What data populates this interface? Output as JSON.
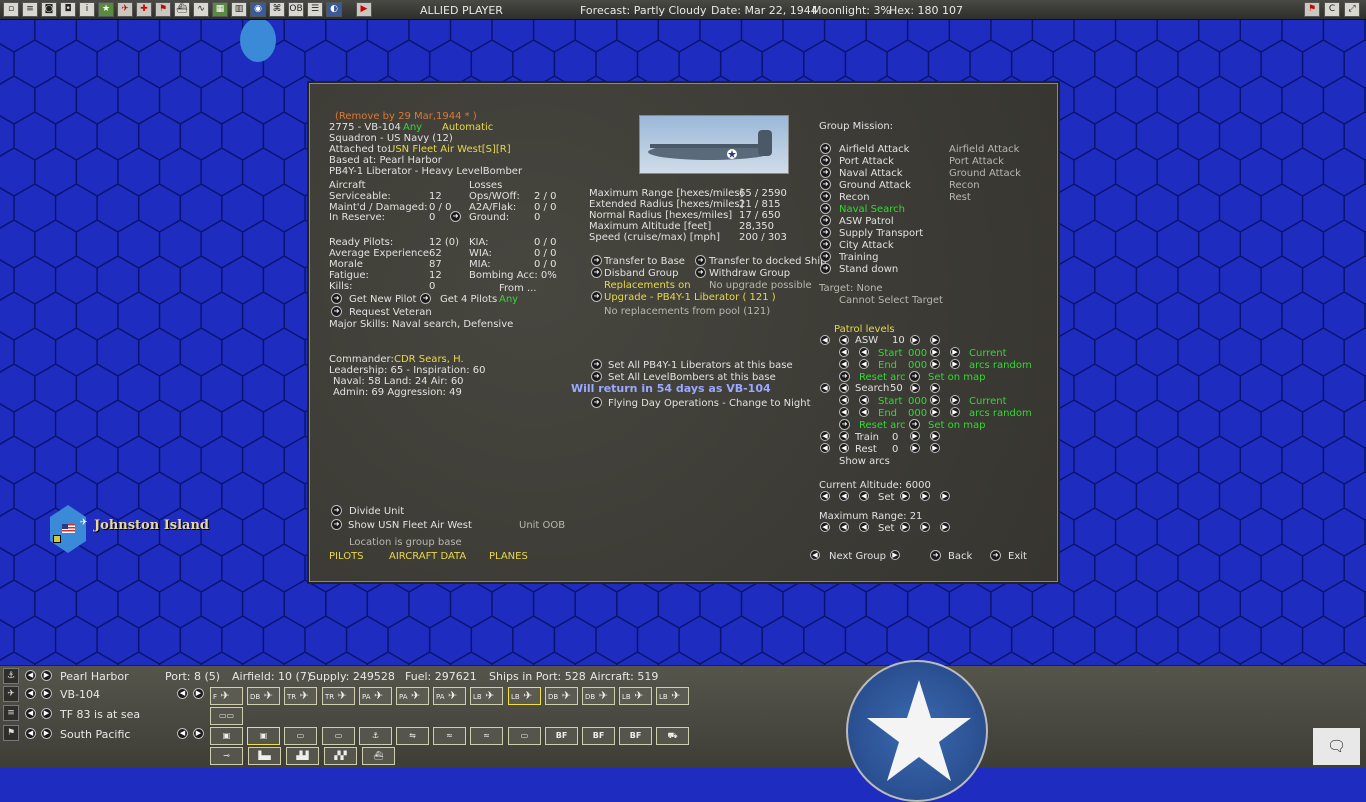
{
  "topbar": {
    "player": "ALLIED PLAYER",
    "forecast": "Forecast: Partly Cloudy",
    "date": "Date: Mar 22, 1944",
    "moonlight": "Moonlight: 3%",
    "hex": "Hex: 180 107"
  },
  "map": {
    "base_name": "Johnston Island"
  },
  "unit": {
    "remove": "(Remove by 29 Mar,1944 * )",
    "id": "2775 - VB-104",
    "any": "Any",
    "automatic": "Automatic",
    "squadron": "Squadron - US Navy (12)",
    "attached_label": "Attached to:",
    "attached_value": "USN Fleet Air West[S][R]",
    "based": "Based at: Pearl Harbor",
    "aircraft_type": "PB4Y-1 Liberator - Heavy LevelBomber",
    "aircraft_header": "Aircraft",
    "losses_header": "Losses",
    "serviceable_l": "Serviceable:",
    "serviceable_v": "12",
    "opswoff_l": "Ops/WOff:",
    "opswoff_v": "2 / 0",
    "maintd_l": "Maint'd / Damaged:",
    "maintd_v": "0 / 0",
    "a2a_l": "A2A/Flak:",
    "a2a_v": "0 / 0",
    "reserve_l": "In Reserve:",
    "reserve_v": "0",
    "ground_l": "Ground:",
    "ground_v": "0",
    "ready_l": "Ready Pilots:",
    "ready_v": "12 (0)",
    "kia_l": "KIA:",
    "kia_v": "0 / 0",
    "avgexp_l": "Average Experience",
    "avgexp_v": "62",
    "wia_l": "WIA:",
    "wia_v": "0 / 0",
    "morale_l": "Morale",
    "morale_v": "87",
    "mia_l": "MIA:",
    "mia_v": "0 / 0",
    "fatigue_l": "Fatigue:",
    "fatigue_v": "12",
    "bombacc": "Bombing Acc: 0%",
    "kills_l": "Kills:",
    "kills_v": "0",
    "from": "From ...",
    "get_new_pilot": "Get New Pilot",
    "get_4_pilots": "Get 4 Pilots",
    "any2": "Any",
    "request_veteran": "Request Veteran",
    "major_skills": "Major Skills: Naval search, Defensive",
    "commander_l": "Commander:",
    "commander_v": "CDR Sears, H.",
    "leadership": "Leadership: 65 - Inspiration: 60",
    "naval": "Naval: 58  Land: 24  Air: 60",
    "admin": "Admin: 69  Aggression: 49",
    "divide": "Divide Unit",
    "show_fleet": "Show USN Fleet Air West",
    "unit_oob": "Unit OOB",
    "location": "Location is group base",
    "tab_pilots": "PILOTS",
    "tab_aircraft": "AIRCRAFT DATA",
    "tab_planes": "PLANES"
  },
  "perf": {
    "maxrange_l": "Maximum Range [hexes/miles]",
    "maxrange_v": "65 / 2590",
    "extrad_l": "Extended Radius [hexes/miles]",
    "extrad_v": "21 / 815",
    "normrad_l": "Normal Radius [hexes/miles]",
    "normrad_v": "17 / 650",
    "maxalt_l": "Maximum Altitude [feet]",
    "maxalt_v": "28,350",
    "speed_l": "Speed (cruise/max) [mph]",
    "speed_v": "200 / 303",
    "transfer_base": "Transfer to Base",
    "transfer_ship": "Transfer to docked Ship",
    "disband": "Disband Group",
    "withdraw": "Withdraw Group",
    "replacements_on": "Replacements on",
    "no_upgrade": "No upgrade possible",
    "upgrade": "Upgrade - PB4Y-1 Liberator  ( 121 )",
    "no_repl": "No replacements from pool (121)",
    "set_all_lib": "Set All PB4Y-1 Liberators at this base",
    "set_all_lb": "Set All LevelBombers at this base",
    "will_return": "Will return in 54 days as VB-104",
    "flying_day": "Flying Day Operations - Change to Night"
  },
  "mission": {
    "header": "Group Mission:",
    "items": [
      "Airfield Attack",
      "Port Attack",
      "Naval Attack",
      "Ground Attack",
      "Recon",
      "Naval Search",
      "ASW Patrol",
      "Supply Transport",
      "City Attack",
      "Training",
      "Stand down"
    ],
    "secondary": [
      "Airfield Attack",
      "Port Attack",
      "Ground Attack",
      "Recon",
      "Rest"
    ],
    "target": "Target: None",
    "cannot_select": "Cannot Select Target",
    "patrol_levels": "Patrol levels",
    "asw_l": "ASW",
    "asw_v": "10",
    "start_l": "Start",
    "start_v": "000",
    "end_l": "End",
    "end_v": "000",
    "current": "Current",
    "arcs_random": "arcs random",
    "reset_arc": "Reset arc",
    "set_on_map": "Set on map",
    "search_l": "Search",
    "search_v": "50",
    "train_l": "Train",
    "train_v": "0",
    "rest_l": "Rest",
    "rest_v": "0",
    "show_arcs": "Show arcs",
    "cur_alt": "Current Altitude: 6000",
    "set": "Set",
    "max_range": "Maximum Range: 21",
    "next_group": "Next Group",
    "back": "Back",
    "exit": "Exit"
  },
  "bottom": {
    "base": "Pearl Harbor",
    "port": "Port: 8 (5)",
    "airfield": "Airfield: 10 (7)",
    "supply": "Supply: 249528",
    "fuel": "Fuel: 297621",
    "ships": "Ships in Port: 528",
    "aircraft": "Aircraft: 519",
    "squadron": "VB-104",
    "tf": "TF 83 is at sea",
    "region": "South Pacific",
    "air_buttons": [
      "F",
      "DB",
      "TR",
      "TR",
      "PA",
      "PA",
      "PA",
      "LB",
      "LB",
      "DB",
      "DB",
      "LB",
      "LB"
    ],
    "ship_buttons": [
      "",
      "",
      "",
      "",
      "",
      "",
      "",
      "",
      "",
      "BF",
      "BF",
      "BF",
      ""
    ]
  },
  "colors": {
    "ocean": "#1e2cc0",
    "hexline": "#0a1470",
    "panel": "#3f3e38",
    "yellow": "#e8d84a",
    "green": "#34d834",
    "orange": "#e07830"
  }
}
